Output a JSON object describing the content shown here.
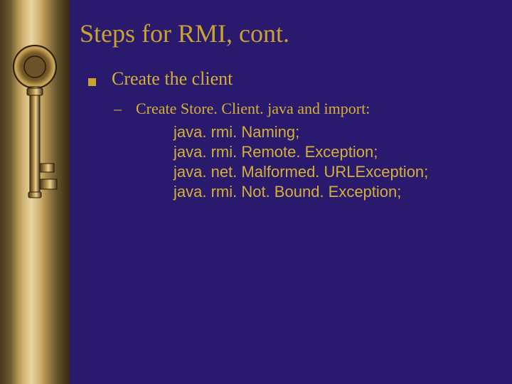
{
  "title": "Steps for RMI, cont.",
  "level1": {
    "text": "Create the client"
  },
  "level2": {
    "text": "Create Store. Client. java and import:"
  },
  "imports": [
    "java. rmi. Naming;",
    "java. rmi. Remote. Exception;",
    "java. net. Malformed. URLException;",
    "java. rmi. Not. Bound. Exception;"
  ]
}
